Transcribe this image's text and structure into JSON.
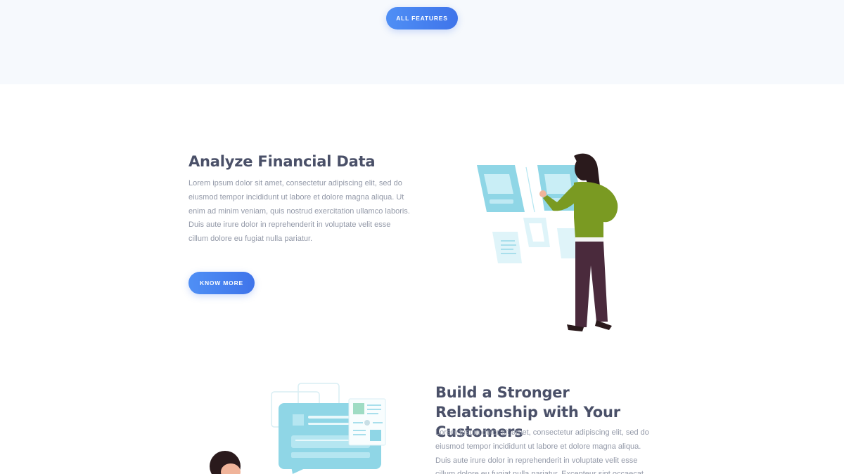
{
  "hero": {
    "all_features_label": "ALL FEATURES"
  },
  "feature1": {
    "title": "Analyze Financial Data",
    "body": "Lorem ipsum dolor sit amet, consectetur adipiscing elit, sed do eiusmod tempor incididunt ut labore et dolore magna aliqua. Ut enim ad minim veniam, quis nostrud exercitation ullamco laboris. Duis aute irure dolor in reprehenderit in voluptate velit esse cillum dolore eu fugiat nulla pariatur.",
    "button_label": "KNOW MORE",
    "illustration": "woman-using-touch-screens-illustration"
  },
  "feature2": {
    "title": "Build a Stronger Relationship with Your Customers",
    "body": "Lorem ipsum dolor sit amet, consectetur adipiscing elit, sed do eiusmod tempor incididunt ut labore et dolore magna aliqua. Duis aute irure dolor in reprehenderit in voluptate velit esse cillum dolore eu fugiat nulla pariatur. Excepteur sint occaecat",
    "illustration": "chat-bubble-customer-illustration"
  },
  "colors": {
    "accent": "#4f8ff5",
    "accent_dark": "#3f74ea",
    "heading": "#4a5068",
    "body_text": "#9399a8",
    "band_bg": "#f6f9fd",
    "panel_cyan": "#8fd6e6"
  }
}
